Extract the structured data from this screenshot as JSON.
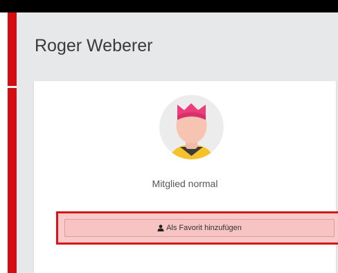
{
  "profile": {
    "name": "Roger Weberer",
    "avatar_icon": "user-avatar-illustration",
    "member_status": "Mitglied normal"
  },
  "actions": {
    "favorite_button": {
      "label": "Als Favorit hinzufügen",
      "icon": "user-icon"
    }
  },
  "colors": {
    "accent_red": "#d10f10",
    "highlight_border": "#d6151b",
    "highlight_fill": "#f9caca",
    "page_background": "#e7e8ea"
  }
}
